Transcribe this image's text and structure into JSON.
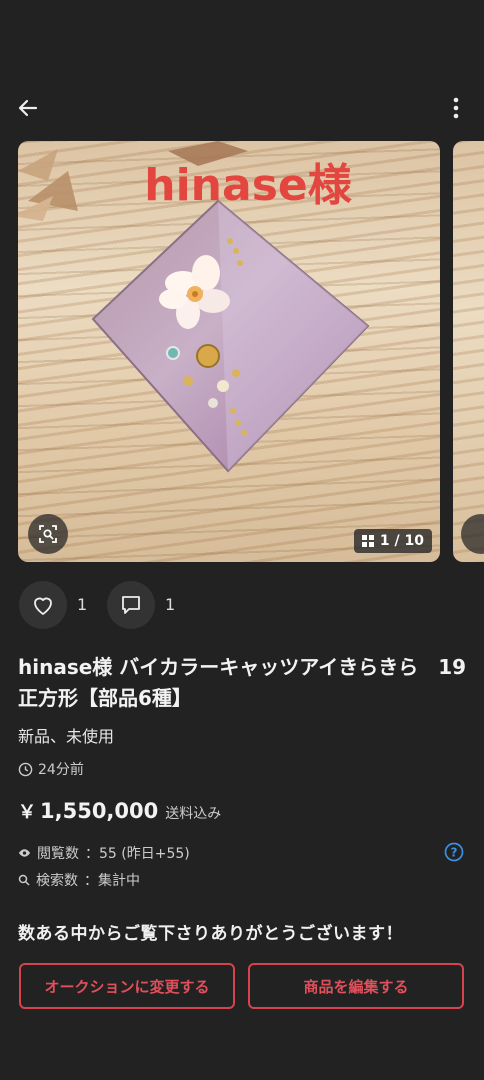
{
  "header": {
    "back_icon": "arrow-left-icon",
    "more_icon": "more-vertical-icon"
  },
  "gallery": {
    "overlay_title": "hinase様",
    "counter": "1 / 10",
    "current_index": 1,
    "total": 10,
    "counter_icon": "grid-icon",
    "scan_icon": "image-search-icon"
  },
  "reactions": {
    "likes": "1",
    "comments": "1",
    "like_icon": "heart-icon",
    "comment_icon": "comment-icon"
  },
  "item": {
    "title": "hinase様 バイカラーキャッツアイきらきら　19　正方形【部品6種】",
    "condition": "新品、未使用",
    "posted": "24分前",
    "price_yen": "￥",
    "price": "1,550,000",
    "shipping": "送料込み"
  },
  "stats": {
    "views_label": "閲覧数",
    "views_value": "：55 (昨日+55)",
    "search_label": "検索数",
    "search_value": "：集計中"
  },
  "message": "数ある中からご覧下さりありがとうございます！",
  "actions": {
    "auction": "オークションに変更する",
    "edit": "商品を編集する"
  },
  "colors": {
    "background": "#222222",
    "accent": "#d6434d",
    "help": "#3d8fe0"
  }
}
